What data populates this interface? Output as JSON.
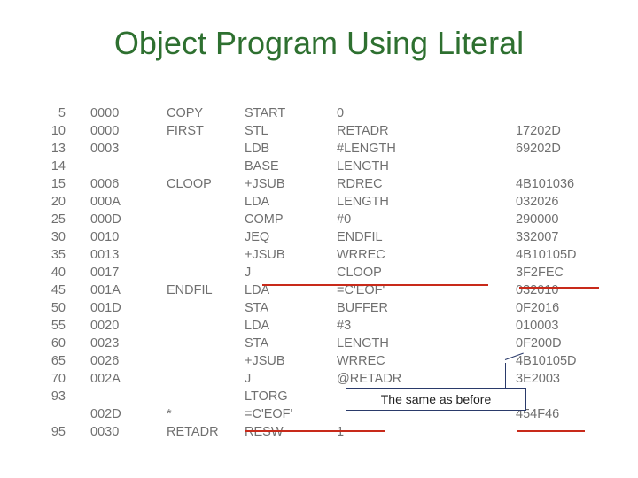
{
  "title": "Object Program Using Literal",
  "callout": "The same as before",
  "rows": [
    {
      "ln": "5",
      "loc": "0000",
      "label": "COPY",
      "op": "START",
      "operand": "0",
      "obj": ""
    },
    {
      "ln": "10",
      "loc": "0000",
      "label": "FIRST",
      "op": "STL",
      "operand": "RETADR",
      "obj": "17202D"
    },
    {
      "ln": "13",
      "loc": "0003",
      "label": "",
      "op": "LDB",
      "operand": "#LENGTH",
      "obj": "69202D"
    },
    {
      "ln": "14",
      "loc": "",
      "label": "",
      "op": "BASE",
      "operand": "LENGTH",
      "obj": ""
    },
    {
      "ln": "15",
      "loc": "0006",
      "label": "CLOOP",
      "op": "+JSUB",
      "operand": "RDREC",
      "obj": "4B101036"
    },
    {
      "ln": "20",
      "loc": "000A",
      "label": "",
      "op": "LDA",
      "operand": "LENGTH",
      "obj": "032026"
    },
    {
      "ln": "25",
      "loc": "000D",
      "label": "",
      "op": "COMP",
      "operand": "#0",
      "obj": "290000"
    },
    {
      "ln": "30",
      "loc": "0010",
      "label": "",
      "op": "JEQ",
      "operand": "ENDFIL",
      "obj": "332007"
    },
    {
      "ln": "35",
      "loc": "0013",
      "label": "",
      "op": "+JSUB",
      "operand": "WRREC",
      "obj": "4B10105D"
    },
    {
      "ln": "40",
      "loc": "0017",
      "label": "",
      "op": "J",
      "operand": "CLOOP",
      "obj": "3F2FEC"
    },
    {
      "ln": "45",
      "loc": "001A",
      "label": "ENDFIL",
      "op": "LDA",
      "operand": "=C'EOF'",
      "obj": "032010"
    },
    {
      "ln": "50",
      "loc": "001D",
      "label": "",
      "op": "STA",
      "operand": "BUFFER",
      "obj": "0F2016"
    },
    {
      "ln": "55",
      "loc": "0020",
      "label": "",
      "op": "LDA",
      "operand": "#3",
      "obj": "010003"
    },
    {
      "ln": "60",
      "loc": "0023",
      "label": "",
      "op": "STA",
      "operand": "LENGTH",
      "obj": "0F200D"
    },
    {
      "ln": "65",
      "loc": "0026",
      "label": "",
      "op": "+JSUB",
      "operand": "WRREC",
      "obj": "4B10105D"
    },
    {
      "ln": "70",
      "loc": "002A",
      "label": "",
      "op": "J",
      "operand": "@RETADR",
      "obj": "3E2003"
    },
    {
      "ln": "93",
      "loc": "",
      "label": "",
      "op": "LTORG",
      "operand": "",
      "obj": ""
    },
    {
      "ln": "",
      "loc": "002D",
      "label": "*",
      "op": "=C'EOF'",
      "operand": "",
      "obj": "454F46"
    },
    {
      "ln": "95",
      "loc": "0030",
      "label": "RETADR",
      "op": "RESW",
      "operand": "1",
      "obj": ""
    }
  ]
}
